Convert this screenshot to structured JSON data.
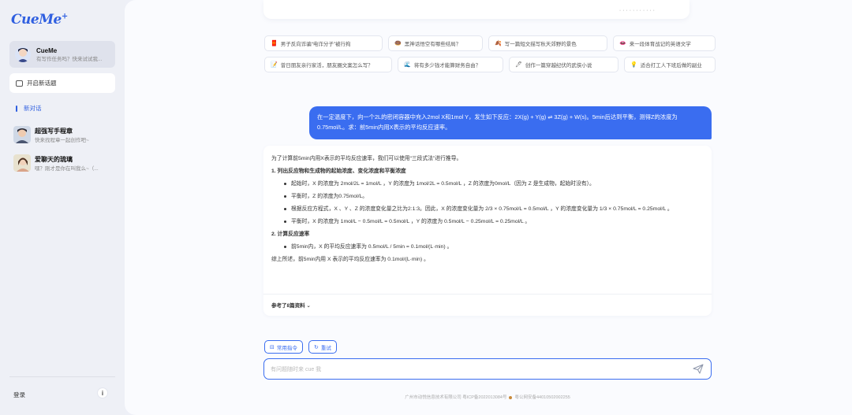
{
  "sidebar": {
    "logo": "CueMe",
    "logo_mark": "+",
    "agent": {
      "name": "CueMe",
      "subtitle": "有写作任务吗？快来试试我..."
    },
    "new_chat_label": "开启新话题",
    "current_chat_label": "新对话",
    "history": [
      {
        "title": "超强写手程章",
        "subtitle": "快来找程章一起创作吧~"
      },
      {
        "title": "爱聊天的琉璃",
        "subtitle": "嘿？刚才是你在叫我么~（..."
      }
    ],
    "login_label": "登录",
    "info_label": "i"
  },
  "main": {
    "top_fragment": "· · · · · · · · · · ·",
    "prompt_chips_row1": [
      {
        "icon": "🧧",
        "label": "男子反向诈骗“电诈分子”被行拘"
      },
      {
        "icon": "🍩",
        "label": "黑神话悟空有哪些结局？"
      },
      {
        "icon": "🍂",
        "label": "写一篇短文描写秋天郊野的景色"
      },
      {
        "icon": "👄",
        "label": "来一段体育战记的英语文学"
      }
    ],
    "prompt_chips_row2": [
      {
        "icon": "📝",
        "label": "曾日朋友亲行家活，朋友圈文案怎么写？"
      },
      {
        "icon": "🌊",
        "label": "将有多少钱才能算财务自由？"
      },
      {
        "icon": "🖊",
        "label": "创作一篇穿越纪伏的武侠小说"
      },
      {
        "icon": "💡",
        "label": "适合打工人下班后做的副业"
      }
    ],
    "user_message": "在一定温度下，向一个2L的密闭容器中充入2mol X和1mol Y，发生如下反应：2X(g) + Y(g) ⇌ 3Z(g) + W(s)。5min后达到平衡，测得Z的浓度为0.75mol/L。求：前5min内用X表示的平均反应速率。",
    "answer": {
      "intro": "为了计算前5min内用X表示的平均反应速率，我们可以使用“三段式法”进行推导。",
      "sections": [
        {
          "heading": "1. 列出反应物和生成物的起始浓度、变化浓度和平衡浓度",
          "items": [
            "起始时，X 的浓度为 2mol/2L = 1mol/L ，Y 的浓度为 1mol/2L = 0.5mol/L ，Z 的浓度为0mol/L（因为 Z 是生成物，起始时没有）。",
            "平衡时，Z 的浓度为0.75mol/L。",
            "根据反应方程式，X 、Y 、Z 的浓度变化量之比为2:1:3。因此，X 的浓度变化量为 2/3 × 0.75mol/L = 0.5mol/L ，Y 的浓度变化量为 1/3 × 0.75mol/L = 0.25mol/L 。",
            "平衡时，X 的浓度为 1mol/L − 0.5mol/L = 0.5mol/L ，Y 的浓度为 0.5mol/L − 0.25mol/L = 0.25mol/L 。"
          ]
        },
        {
          "heading": "2. 计算反应速率",
          "items": [
            "前5min内，X 的平均反应速率为 0.5mol/L / 5min = 0.1mol/(L·min) 。"
          ]
        }
      ],
      "conclusion": "综上所述，前5min内用 X 表示的平均反应速率为 0.1mol/(L·min) 。",
      "refs_label": "参考了8篇资料 ⌄"
    },
    "buttons": {
      "common_commands": "常用指令",
      "retry": "重试"
    },
    "input_placeholder": "有问题随时来 cue 我",
    "footer_company": "广州市动悦信息技术有限公司 粤ICP备2022013084号",
    "footer_police": "粤公网安备44010502002255"
  }
}
